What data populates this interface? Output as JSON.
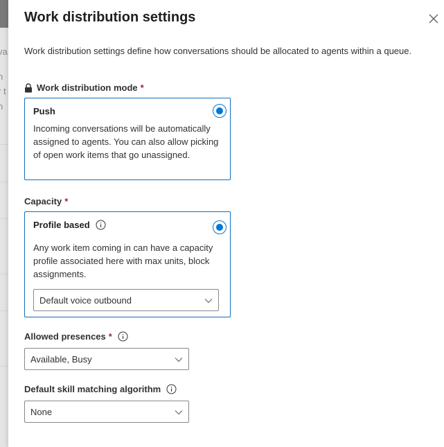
{
  "backdrop": {
    "fragments": [
      "va",
      "n",
      "r t",
      "n"
    ]
  },
  "panel": {
    "title": "Work distribution settings",
    "description": "Work distribution settings define how conversations should be allocated to agents within a queue."
  },
  "work_distribution_mode": {
    "label": "Work distribution mode",
    "required_mark": "*",
    "option": {
      "title": "Push",
      "text": "Incoming conversations will be automatically assigned to agents. You can also allow picking of open work items that go unassigned.",
      "selected": true
    }
  },
  "capacity": {
    "label": "Capacity",
    "required_mark": "*",
    "option": {
      "title": "Profile based",
      "text": "Any work item coming in can have a capacity profile associated here with max units, block assignments.",
      "selected": true,
      "profile_select_value": "Default voice outbound"
    }
  },
  "allowed_presences": {
    "label": "Allowed presences",
    "required_mark": "*",
    "value": "Available, Busy"
  },
  "skill_matching": {
    "label": "Default skill matching algorithm",
    "value": "None"
  },
  "colors": {
    "accent": "#0078d4",
    "required": "#a4262c",
    "card_border": "#0f6cbd"
  }
}
